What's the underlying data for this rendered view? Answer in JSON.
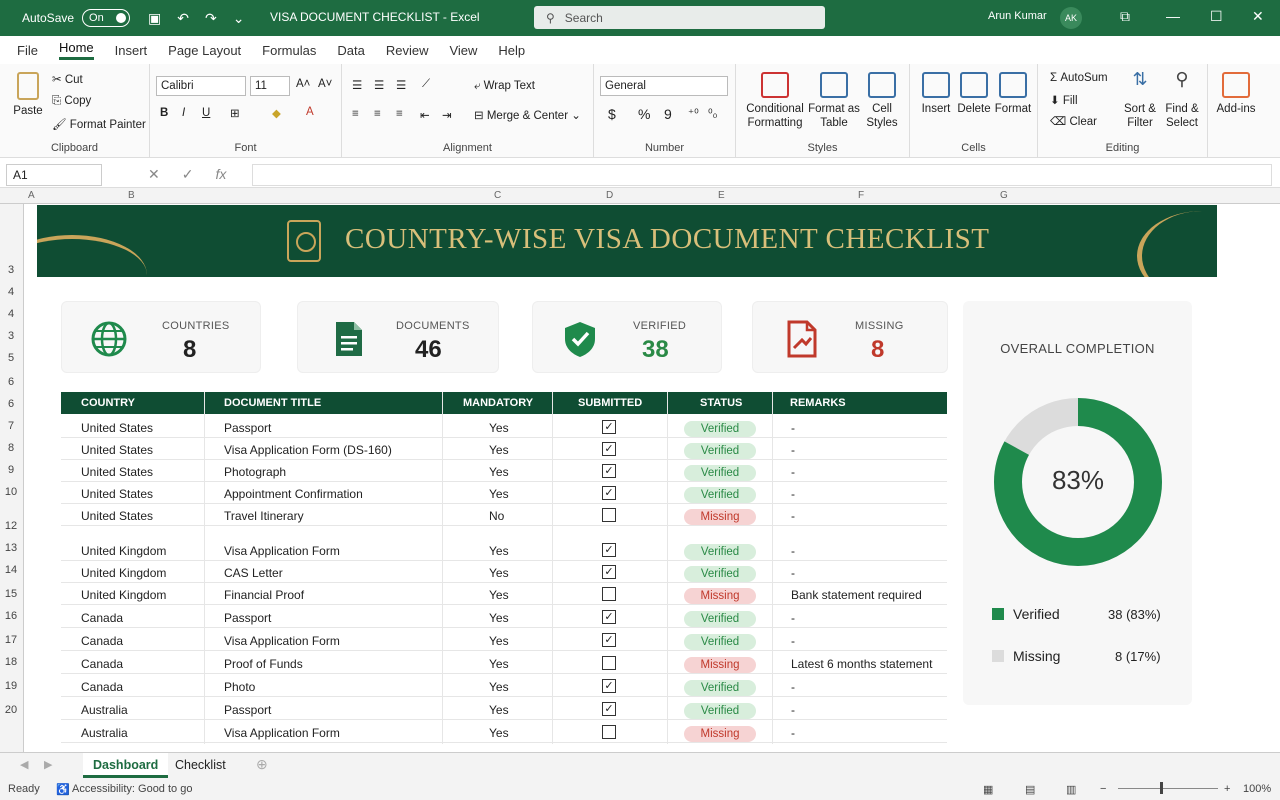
{
  "titlebar": {
    "autosave": "AutoSave",
    "toggle": "On",
    "doc_title": "VISA DOCUMENT CHECKLIST  -  Excel",
    "search_placeholder": "Search",
    "user": "Arun Kumar",
    "initials": "AK"
  },
  "menu": [
    "File",
    "Home",
    "Insert",
    "Page Layout",
    "Formulas",
    "Data",
    "Review",
    "View",
    "Help"
  ],
  "ribbon": {
    "clipboard": {
      "paste": "Paste",
      "cut": "Cut",
      "copy": "Copy",
      "format_painter": "Format Painter",
      "label": "Clipboard"
    },
    "font": {
      "name": "Calibri",
      "size": "11",
      "label": "Font"
    },
    "alignment": {
      "wrap": "Wrap Text",
      "merge": "Merge & Center",
      "label": "Alignment"
    },
    "number": {
      "format": "General",
      "label": "Number"
    },
    "styles": {
      "cond": "Conditional Formatting",
      "table": "Format as Table",
      "cell": "Cell Styles",
      "label": "Styles"
    },
    "cells": {
      "insert": "Insert",
      "delete": "Delete",
      "format": "Format",
      "label": "Cells"
    },
    "editing": {
      "autosum": "AutoSum",
      "fill": "Fill",
      "clear": "Clear",
      "sort": "Sort & Filter",
      "find": "Find & Select",
      "label": "Editing"
    },
    "addins": {
      "label": "Add-ins"
    }
  },
  "formula_bar": {
    "namebox": "A1",
    "fx": "fx"
  },
  "columns": [
    "A",
    "B",
    "C",
    "D",
    "E",
    "F",
    "G"
  ],
  "rows": [
    "3",
    "4",
    "4",
    "3",
    "5",
    "6",
    "6",
    "7",
    "8",
    "9",
    "10",
    "12",
    "13",
    "14",
    "15",
    "16",
    "17",
    "18",
    "19",
    "20"
  ],
  "banner": {
    "title": "COUNTRY-WISE VISA DOCUMENT CHECKLIST"
  },
  "cards": [
    {
      "label": "COUNTRIES",
      "value": "8",
      "color": "#222222"
    },
    {
      "label": "DOCUMENTS",
      "value": "46",
      "color": "#222222"
    },
    {
      "label": "VERIFIED",
      "value": "38",
      "color": "#2a8a46"
    },
    {
      "label": "MISSING",
      "value": "8",
      "color": "#c0392b"
    }
  ],
  "table": {
    "headers": [
      "COUNTRY",
      "DOCUMENT TITLE",
      "MANDATORY",
      "SUBMITTED",
      "STATUS",
      "REMARKS"
    ],
    "rows": [
      {
        "country": "United States",
        "doc": "Passport",
        "mand": "Yes",
        "sub": true,
        "status": "Verified",
        "remarks": "-"
      },
      {
        "country": "United States",
        "doc": "Visa Application Form (DS-160)",
        "mand": "Yes",
        "sub": true,
        "status": "Verified",
        "remarks": "-"
      },
      {
        "country": "United States",
        "doc": "Photograph",
        "mand": "Yes",
        "sub": true,
        "status": "Verified",
        "remarks": "-"
      },
      {
        "country": "United States",
        "doc": "Appointment Confirmation",
        "mand": "Yes",
        "sub": true,
        "status": "Verified",
        "remarks": "-"
      },
      {
        "country": "United States",
        "doc": "Travel Itinerary",
        "mand": "No",
        "sub": false,
        "status": "Missing",
        "remarks": "-"
      },
      {
        "country": "United Kingdom",
        "doc": "Visa Application Form",
        "mand": "Yes",
        "sub": true,
        "status": "Verified",
        "remarks": "-"
      },
      {
        "country": "United Kingdom",
        "doc": "CAS Letter",
        "mand": "Yes",
        "sub": true,
        "status": "Verified",
        "remarks": "-"
      },
      {
        "country": "United Kingdom",
        "doc": "Financial Proof",
        "mand": "Yes",
        "sub": false,
        "status": "Missing",
        "remarks": "Bank statement required"
      },
      {
        "country": "Canada",
        "doc": "Passport",
        "mand": "Yes",
        "sub": true,
        "status": "Verified",
        "remarks": "-"
      },
      {
        "country": "Canada",
        "doc": "Visa Application Form",
        "mand": "Yes",
        "sub": true,
        "status": "Verified",
        "remarks": "-"
      },
      {
        "country": "Canada",
        "doc": "Proof of Funds",
        "mand": "Yes",
        "sub": false,
        "status": "Missing",
        "remarks": "Latest 6 months statement"
      },
      {
        "country": "Canada",
        "doc": "Photo",
        "mand": "Yes",
        "sub": true,
        "status": "Verified",
        "remarks": "-"
      },
      {
        "country": "Australia",
        "doc": "Passport",
        "mand": "Yes",
        "sub": true,
        "status": "Verified",
        "remarks": "-"
      },
      {
        "country": "Australia",
        "doc": "Visa Application Form",
        "mand": "Yes",
        "sub": false,
        "status": "Missing",
        "remarks": "-"
      }
    ]
  },
  "completion": {
    "title": "OVERALL COMPLETION",
    "percent_label": "83%",
    "percent": 0.83,
    "legend": [
      {
        "name": "Verified",
        "value": "38 (83%)",
        "color": "#1f8a4c"
      },
      {
        "name": "Missing",
        "value": "8 (17%)",
        "color": "#dcdcdc"
      }
    ]
  },
  "tabs": [
    "Dashboard",
    "Checklist"
  ],
  "status": {
    "ready": "Ready",
    "accessibility": "Accessibility: Good to go",
    "zoom": "100%"
  }
}
